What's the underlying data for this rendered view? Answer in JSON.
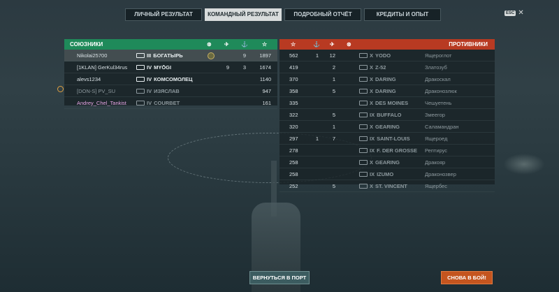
{
  "tabs": [
    "ЛИЧНЫЙ РЕЗУЛЬТАТ",
    "КОМАНДНЫЙ РЕЗУЛЬТАТ",
    "ПОДРОБНЫЙ ОТЧЁТ",
    "КРЕДИТЫ И ОПЫТ"
  ],
  "active_tab": "КОМАНДНЫЙ РЕЗУЛЬТАТ",
  "esc_label": "ESC",
  "allies": {
    "title": "СОЮЗНИКИ",
    "rows": [
      {
        "player": "Nikolai25700",
        "tier": "III",
        "ship": "БОГАТЫРЬ",
        "medal": true,
        "planes": "",
        "kills": "9",
        "score": "1897",
        "me": true
      },
      {
        "player": "[1KLAN] GerKul34rus",
        "tier": "IV",
        "ship": "MYŌGI",
        "medal": false,
        "planes": "9",
        "kills": "3",
        "score": "1674",
        "me": false
      },
      {
        "player": "alevs1234",
        "tier": "IV",
        "ship": "КОМСОМОЛЕЦ",
        "medal": false,
        "planes": "",
        "kills": "",
        "score": "1140",
        "me": false
      },
      {
        "player": "[DON-S] PV_SU",
        "tier": "IV",
        "ship": "ИЗЯСЛАВ",
        "medal": false,
        "planes": "",
        "kills": "",
        "score": "947",
        "me": false,
        "dead": true
      },
      {
        "player": "Andrey_Chel_Tankist",
        "tier": "IV",
        "ship": "COURBET",
        "medal": false,
        "planes": "",
        "kills": "",
        "score": "161",
        "me": false,
        "dead": true,
        "pink": true
      }
    ]
  },
  "enemies": {
    "title": "ПРОТИВНИКИ",
    "rows": [
      {
        "score": "562",
        "kills": "1",
        "planes": "12",
        "tier": "X",
        "ship": "YODO",
        "player": "Ящероглот"
      },
      {
        "score": "419",
        "kills": "",
        "planes": "2",
        "tier": "X",
        "ship": "Z-52",
        "player": "Златозуб"
      },
      {
        "score": "370",
        "kills": "",
        "planes": "1",
        "tier": "X",
        "ship": "DARING",
        "player": "Дракоскал"
      },
      {
        "score": "358",
        "kills": "",
        "planes": "5",
        "tier": "X",
        "ship": "DARING",
        "player": "Драконозлюк"
      },
      {
        "score": "335",
        "kills": "",
        "planes": "",
        "tier": "X",
        "ship": "DES MOINES",
        "player": "Чешуетень"
      },
      {
        "score": "322",
        "kills": "",
        "planes": "5",
        "tier": "IX",
        "ship": "BUFFALO",
        "player": "Змеегор"
      },
      {
        "score": "320",
        "kills": "",
        "planes": "1",
        "tier": "X",
        "ship": "GEARING",
        "player": "Саламандран"
      },
      {
        "score": "297",
        "kills": "1",
        "planes": "7",
        "tier": "IX",
        "ship": "SAINT-LOUIS",
        "player": "Ящероед"
      },
      {
        "score": "278",
        "kills": "",
        "planes": "",
        "tier": "IX",
        "ship": "F. DER GROSSE",
        "player": "Рептирус"
      },
      {
        "score": "258",
        "kills": "",
        "planes": "",
        "tier": "X",
        "ship": "GEARING",
        "player": "Дракояр"
      },
      {
        "score": "258",
        "kills": "",
        "planes": "",
        "tier": "IX",
        "ship": "IZUMO",
        "player": "Драконозвер"
      },
      {
        "score": "252",
        "kills": "",
        "planes": "5",
        "tier": "X",
        "ship": "ST. VINCENT",
        "player": "Ящербес"
      }
    ]
  },
  "buttons": {
    "port": "ВЕРНУТЬСЯ В ПОРТ",
    "battle": "СНОВА В БОЙ!"
  }
}
